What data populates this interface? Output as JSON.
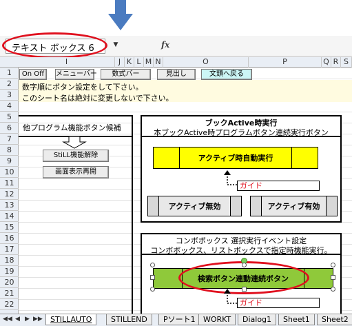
{
  "namebox": {
    "value": "テキスト ボックス 6"
  },
  "formula_bar": {
    "fx": "fx",
    "dropdown": "▼"
  },
  "columns": [
    "I",
    "J",
    "K",
    "L",
    "M",
    "N",
    "O",
    "P",
    "Q",
    "R",
    "S"
  ],
  "rows": [
    "1",
    "2",
    "3",
    "4",
    "5",
    "6",
    "7",
    "8",
    "9",
    "10",
    "11",
    "12",
    "13",
    "14",
    "15",
    "16",
    "17",
    "18",
    "19",
    "20",
    "21",
    "22"
  ],
  "toolbar": {
    "onoff": "On Off",
    "menubar": "メニューバー",
    "formulabar": "数式バー",
    "heading": "見出し",
    "return_top": "文頭へ戻る"
  },
  "notes": {
    "line2": "数字順にボタン設定をして下さい。",
    "line3": "このシート名は絶対に変更しないで下さい。"
  },
  "left_panel": {
    "title": "他プログラム機能ボタン候補",
    "btn_still_cancel": "StiLL機能解除",
    "btn_screen_resume": "画面表示再開"
  },
  "book_active": {
    "title": "ブックActive時実行",
    "subtitle": "本ブックActive時プログラムボタン連続実行ボタン",
    "auto_run": "アクティブ時自動実行",
    "guide": "ガイド",
    "disable": "アクティブ無効",
    "enable": "アクティブ有効"
  },
  "combo": {
    "title": "コンボボックス 選択実行イベント設定",
    "subtitle": "コンボボックス、リストボックスで指定時機能実行。",
    "search_btn": "検索ボタン連動連続ボタン",
    "guide": "ガイド"
  },
  "sheet_tabs": {
    "nav": [
      "◀◀",
      "◀",
      "▶",
      "▶▶"
    ],
    "tabs": [
      "STILLAUTO",
      "STILLEND",
      "Pソート1",
      "WORKT",
      "Dialog1",
      "Sheet1",
      "Sheet2"
    ],
    "active_index": 0
  },
  "colors": {
    "yellow_button": "#ffff00",
    "green_button": "#8fc93a",
    "highlight_ring": "#e0101e",
    "arrow": "#4a7bc0"
  }
}
